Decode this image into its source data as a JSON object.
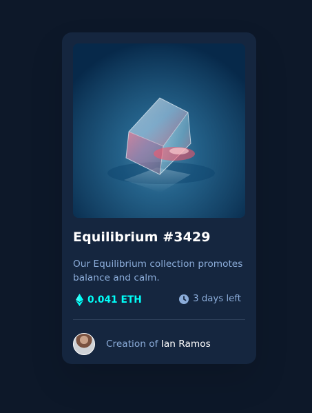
{
  "card": {
    "title": "Equilibrium #3429",
    "description": "Our Equilibrium collection promotes balance and calm.",
    "price": "0.041 ETH",
    "time_left": "3 days left",
    "creator_label": "Creation of",
    "creator_name": "Ian Ramos"
  },
  "icons": {
    "price": "ethereum-icon",
    "time": "clock-icon",
    "avatar": "avatar"
  },
  "colors": {
    "background": "#0d1829",
    "card": "#15263f",
    "accent": "#00fff8",
    "muted_text": "#8bacd9",
    "white": "#ffffff",
    "divider": "#2e405a"
  }
}
